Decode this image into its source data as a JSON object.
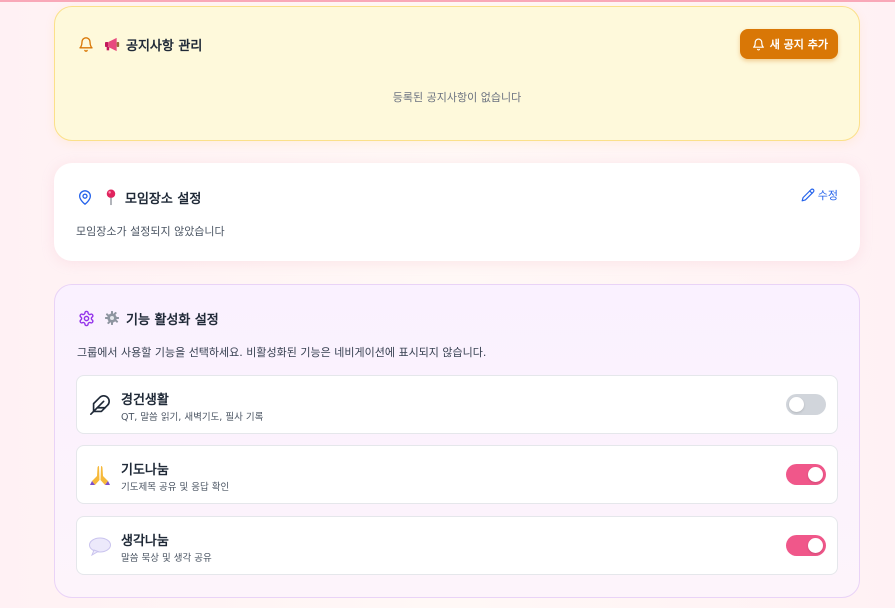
{
  "notices": {
    "title": "공지사항 관리",
    "add_button": "새 공지 추가",
    "empty_text": "등록된 공지사항이 없습니다",
    "title_icon": "bell-icon",
    "title_emoji": "megaphone-icon",
    "accent_color": "#d97706"
  },
  "location": {
    "title": "모임장소 설정",
    "edit_button": "수정",
    "empty_text": "모임장소가 설정되지 않았습니다",
    "title_icon": "map-pin-icon",
    "title_emoji": "pushpin-icon",
    "accent_color": "#2563eb"
  },
  "features": {
    "title": "기능 활성화 설정",
    "description": "그룹에서 사용할 기능을 선택하세요. 비활성화된 기능은 네비게이션에 표시되지 않습니다.",
    "title_icon": "gear-icon",
    "title_emoji": "gear-emoji-icon",
    "items": [
      {
        "name": "경건생활",
        "desc": "QT, 말씀 읽기, 새벽기도, 필사 기록",
        "icon": "feather-icon",
        "enabled": false
      },
      {
        "name": "기도나눔",
        "desc": "기도제목 공유 및 응답 확인",
        "icon": "praying-hands-icon",
        "enabled": true
      },
      {
        "name": "생각나눔",
        "desc": "말씀 묵상 및 생각 공유",
        "icon": "speech-bubble-icon",
        "enabled": true
      }
    ],
    "toggle_on_color": "#f0578a",
    "toggle_off_color": "#d1d5db"
  }
}
